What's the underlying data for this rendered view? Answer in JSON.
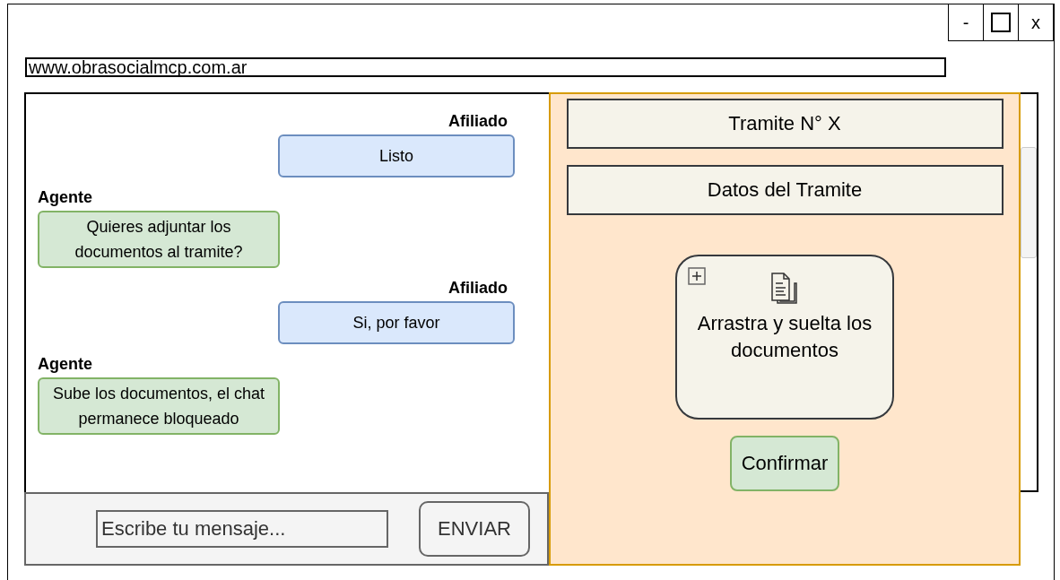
{
  "window_controls": [
    "-",
    "x"
  ],
  "address_bar": {
    "value": "www.obrasocialmcp.com.ar"
  },
  "chat": {
    "messages": [
      {
        "kind": "user",
        "sender": "Afiliado",
        "text": "Listo"
      },
      {
        "kind": "agent",
        "sender": "Agente",
        "text": "Quieres adjuntar los documentos al tramite?"
      },
      {
        "kind": "user",
        "sender": "Afiliado",
        "text": "Si, por favor"
      },
      {
        "kind": "agent",
        "sender": "Agente",
        "text": "Sube los documentos, el chat permanece bloqueado"
      }
    ],
    "input": {
      "placeholder": "Escribe tu mensaje..."
    },
    "send_button": "ENVIAR"
  },
  "panel": {
    "title": "Tramite N° X",
    "details": "Datos del Tramite",
    "dropzone": "Arrastra y suelta los documentos",
    "confirm_button": "Confirmar"
  }
}
